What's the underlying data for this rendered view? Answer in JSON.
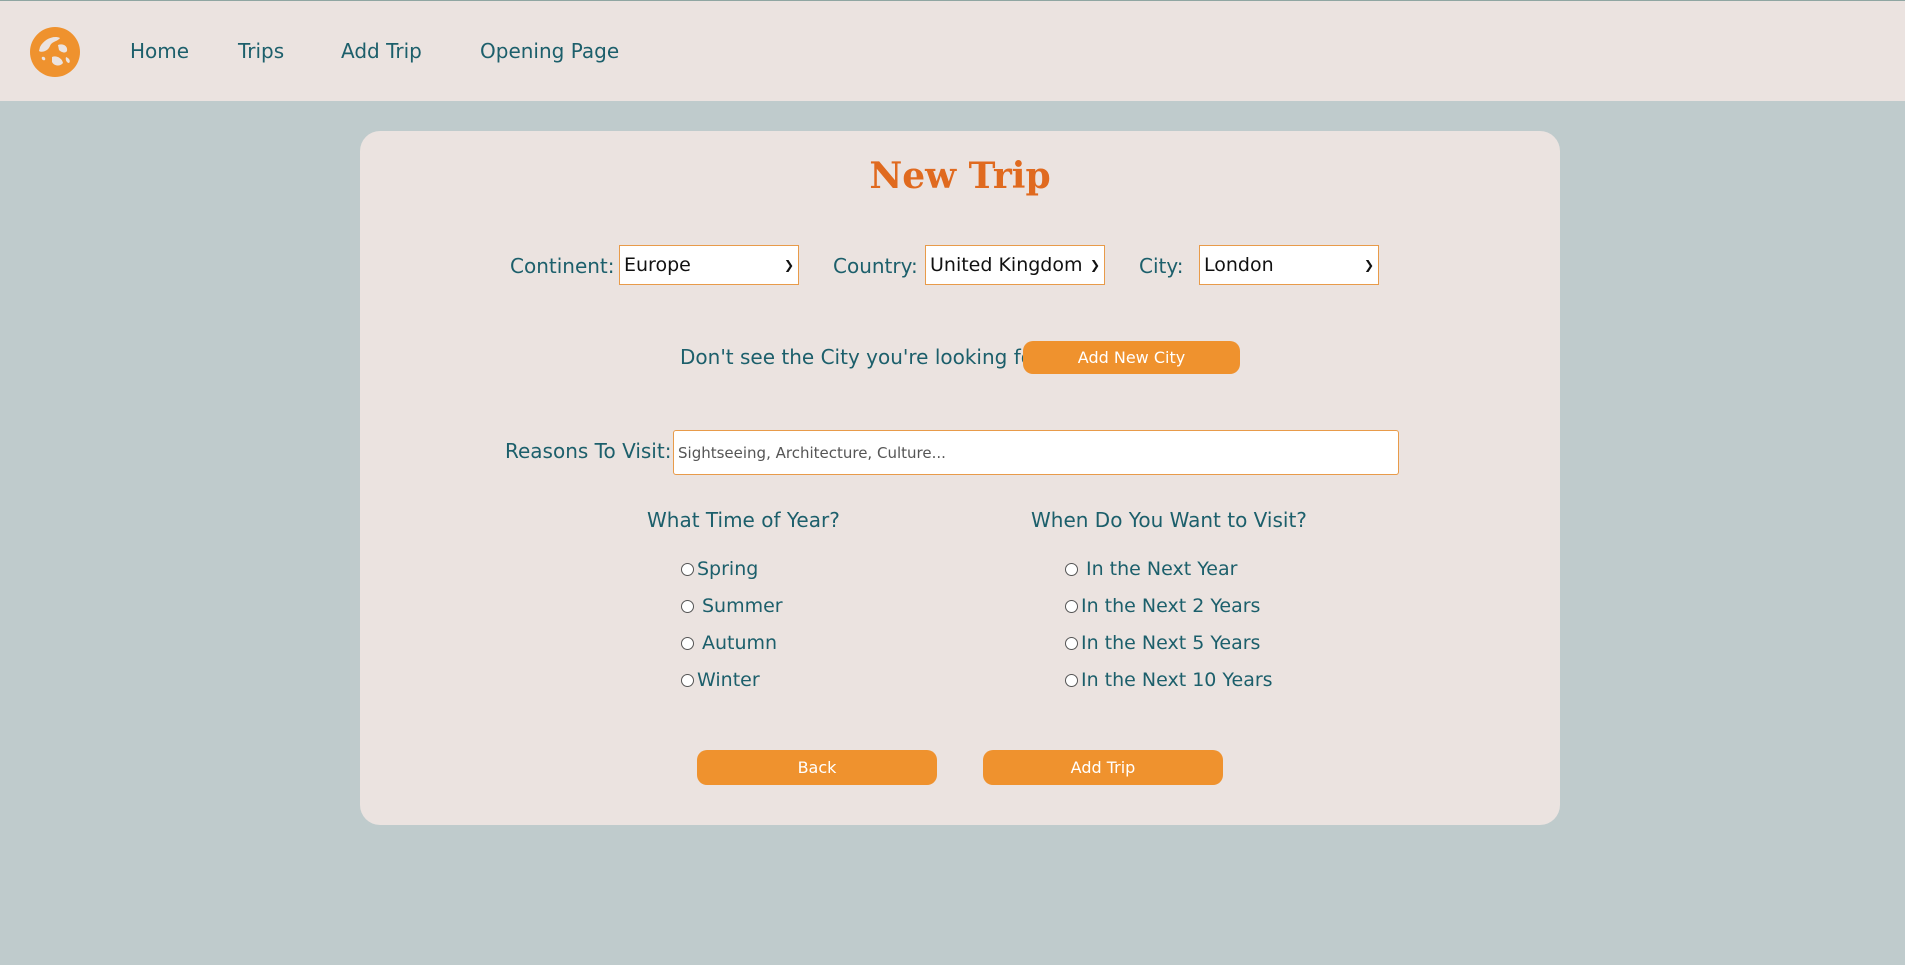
{
  "nav": {
    "links": [
      "Home",
      "Trips",
      "Add Trip",
      "Opening Page"
    ]
  },
  "form": {
    "title": "New Trip",
    "continent_label": "Continent:",
    "continent_value": "Europe",
    "country_label": "Country:",
    "country_value": "United Kingdom",
    "city_label": "City:",
    "city_value": "London",
    "missing_city_text": "Don't see the City you're looking for?",
    "add_city_button": "Add New City",
    "reasons_label": "Reasons To Visit:",
    "reasons_placeholder": "Sightseeing, Architecture, Culture...",
    "time_of_year_heading": "What Time of Year?",
    "seasons": [
      "Spring",
      "Summer",
      "Autumn",
      "Winter"
    ],
    "when_heading": "When Do You Want to Visit?",
    "when_options": [
      "In the Next Year",
      "In the Next 2 Years",
      "In the Next 5 Years",
      "In the Next 10 Years"
    ],
    "back_button": "Back",
    "submit_button": "Add Trip"
  },
  "colors": {
    "accent": "#ef922e",
    "title": "#e06a1f",
    "text": "#1c5f6b",
    "background": "#bfcbcc",
    "panel": "#ebe3e0"
  }
}
